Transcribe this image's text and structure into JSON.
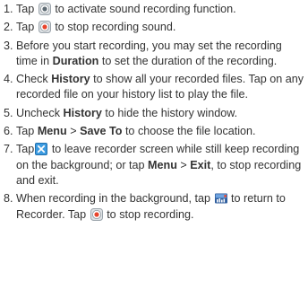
{
  "steps": [
    {
      "num": "1.",
      "a": "Tap",
      "b": "to activate sound recording function."
    },
    {
      "num": "2.",
      "a": "Tap",
      "b": "to stop recording sound."
    },
    {
      "num": "3.",
      "a": "Before you start recording, you may set the recording time in",
      "bold1": "Duration",
      "b": "to set the duration of the recording."
    },
    {
      "num": "4.",
      "a": "Check",
      "bold1": "History",
      "b": "to show all your recorded files. Tap on any recorded file on your history list to play the file."
    },
    {
      "num": "5.",
      "a": "Uncheck",
      "bold1": "History",
      "b": "to hide the history window."
    },
    {
      "num": "6.",
      "a": "Tap",
      "bold1": "Menu",
      "sep": ">",
      "bold2": "Save To",
      "b": "to choose the file location."
    },
    {
      "num": "7.",
      "a": "Tap",
      "b": "to leave recorder screen while still keep recording on the background; or tap",
      "bold1": "Menu",
      "sep": ">",
      "bold2": "Exit",
      "c": ", to stop recording and exit."
    },
    {
      "num": "8.",
      "a": "When recording in the background, tap",
      "b": "to return to Recorder. Tap",
      "c": "to stop recording."
    }
  ],
  "icons": {
    "record": "record-icon",
    "stop": "stop-icon",
    "close": "close-icon",
    "recorder_status": "recorder-status-icon"
  }
}
